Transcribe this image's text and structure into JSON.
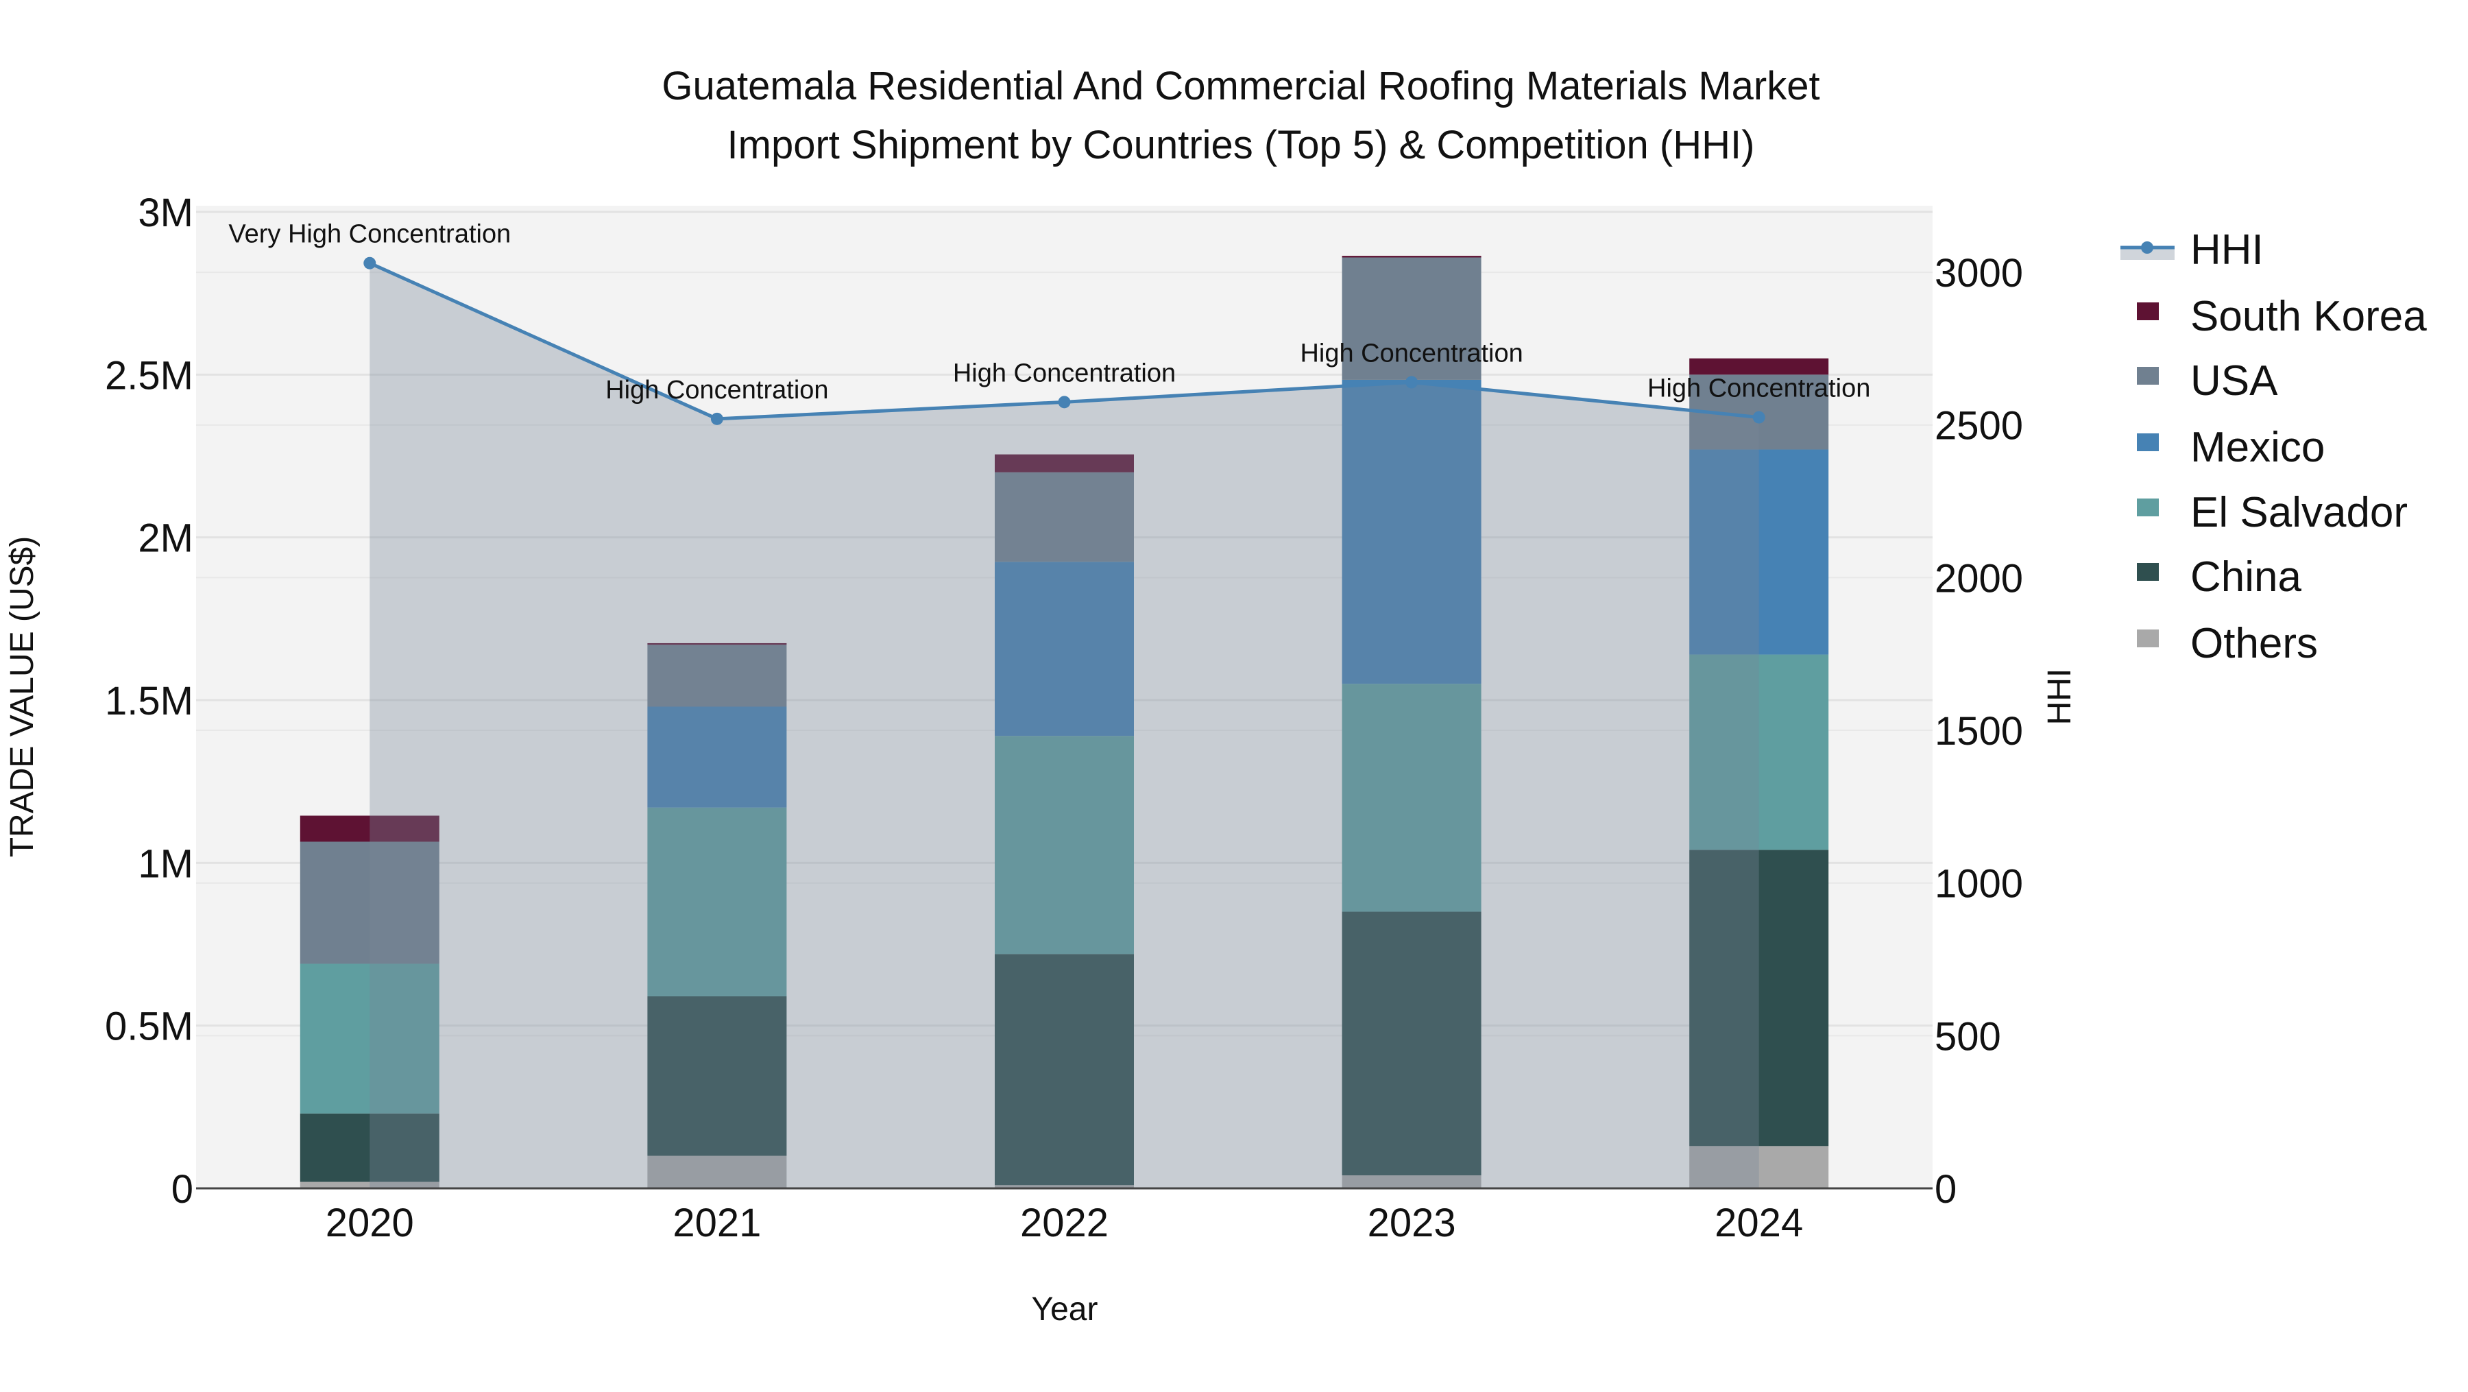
{
  "chart_data": {
    "type": "bar",
    "title_line1": "Guatemala Residential And Commercial Roofing Materials Market",
    "title_line2": "Import Shipment by Countries (Top 5) & Competition (HHI)",
    "xlabel": "Year",
    "ylabel": "TRADE VALUE (US$)",
    "y2label": "HHI",
    "categories": [
      "2020",
      "2021",
      "2022",
      "2023",
      "2024"
    ],
    "ylim": [
      0,
      3019000
    ],
    "y_ticks": [
      0,
      500000,
      1000000,
      1500000,
      2000000,
      2500000,
      3000000
    ],
    "y_tick_labels": [
      "0",
      "0.5M",
      "1M",
      "1.5M",
      "2M",
      "2.5M",
      "3M"
    ],
    "y2lim": [
      0,
      3218
    ],
    "y2_ticks": [
      0,
      500,
      1000,
      1500,
      2000,
      2500,
      3000
    ],
    "y2_tick_labels": [
      "0",
      "500",
      "1000",
      "1500",
      "2000",
      "2500",
      "3000"
    ],
    "stacked_series": [
      {
        "name": "Others",
        "color": "#a9a9a9",
        "values": [
          20000,
          100000,
          10000,
          40000,
          130000
        ]
      },
      {
        "name": "China",
        "color": "#2f4f4f",
        "values": [
          210000,
          490000,
          710000,
          810000,
          910000
        ]
      },
      {
        "name": "El Salvador",
        "color": "#5f9ea0",
        "values": [
          460000,
          580000,
          670000,
          700000,
          600000
        ]
      },
      {
        "name": "Mexico",
        "color": "#4682b4",
        "values": [
          0,
          310000,
          535000,
          934000,
          630000
        ]
      },
      {
        "name": "USA",
        "color": "#708090",
        "values": [
          375000,
          190000,
          275000,
          376000,
          230000
        ]
      },
      {
        "name": "South Korea",
        "color": "#5e1233",
        "values": [
          80000,
          5000,
          55000,
          5000,
          50000
        ]
      }
    ],
    "line_series": {
      "name": "HHI",
      "color": "#4682b4",
      "fill_color": "#778899",
      "values": [
        3030,
        2520,
        2575,
        2640,
        2525
      ],
      "annotations": [
        "Very High Concentration",
        "High Concentration",
        "High Concentration",
        "High Concentration",
        "High Concentration"
      ]
    },
    "legend": [
      "HHI",
      "South Korea",
      "USA",
      "Mexico",
      "El Salvador",
      "China",
      "Others"
    ],
    "legend_placement": "right",
    "grid": true
  }
}
